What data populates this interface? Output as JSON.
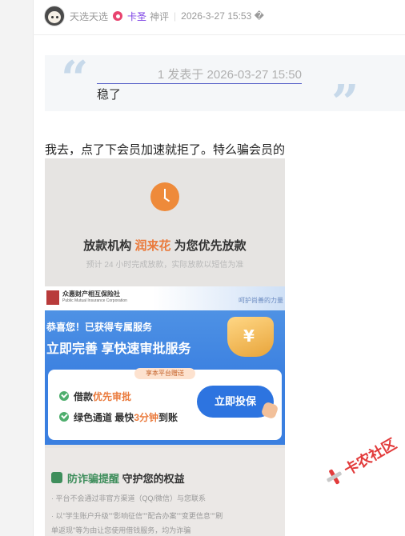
{
  "post_header": {
    "author": "天选天选",
    "role_name": "卡圣",
    "role_sub": "神评",
    "separator": "|",
    "timestamp": "2026-3-27 15:53 �"
  },
  "quote": {
    "reference": "1 发表于 2026-03-27 15:50",
    "text": "稳了"
  },
  "post_body": "我去，点了下会员加速就拒了。特么骗会员的",
  "screenshot": {
    "title_prefix": "放款机构",
    "title_highlight": "润来花",
    "title_suffix": "为您优先放款",
    "subtitle": "预计 24 小时完成放款，实际放款以短信为准",
    "insurer_name": "众惠财产相互保险社",
    "insurer_en": "Public Mutual Insurance Corporation",
    "banner_right": "呵护尚善的力量",
    "congrats": "恭喜您！已获得专属服务",
    "improve": "立即完善 享快速审批服务",
    "card_tag": "享本平台赠送",
    "item1_prefix": "借款",
    "item1_highlight": "优先审批",
    "item2_prefix": "绿色通道 最快",
    "item2_highlight": "3分钟",
    "item2_suffix": "到账",
    "apply_button": "立即投保",
    "anti_fraud_highlight": "防诈骗提醒",
    "anti_fraud_rest": "守护您的权益",
    "anti_fraud_line1": "· 平台不会通过非官方渠道（QQ/微信）与您联系",
    "anti_fraud_line2": "· 以\"学生账户升级\"\"影响征信\"\"配合办案\"\"变更信息\"\"刷",
    "anti_fraud_line3": "单返现\"等为由让您使用借钱服务，均为诈骗"
  },
  "watermark": "卡农社区",
  "colors": {
    "role": "#7b3fe4",
    "highlight_orange": "#ea7a3c",
    "banner_blue": "#3a7fe0",
    "watermark_red": "#e23b3b"
  }
}
